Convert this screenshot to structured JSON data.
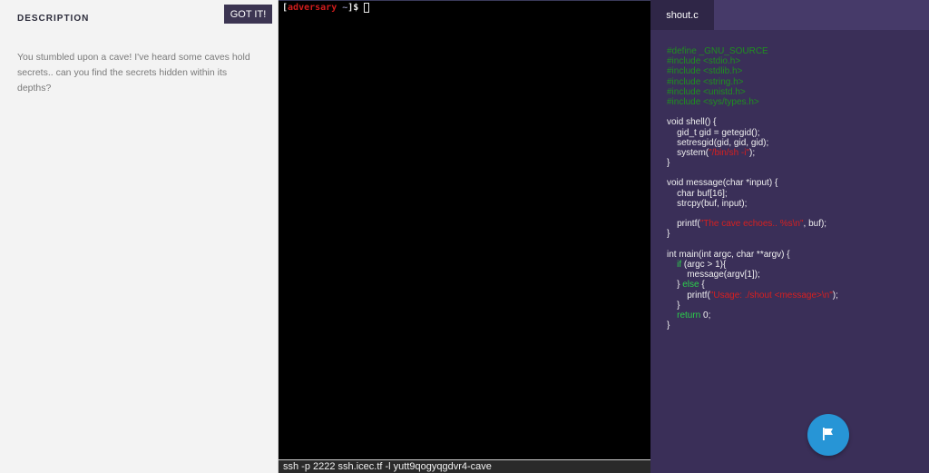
{
  "description": {
    "title": "DESCRIPTION",
    "button_label": "GOT IT!",
    "text": "You stumbled upon a cave! I've heard some caves hold secrets.. can you find the secrets hidden within its depths?"
  },
  "terminal": {
    "bracket_open": "[",
    "user": "adversary",
    "tilde": "~",
    "suffix": "]$",
    "ssh_command": "ssh -p 2222 ssh.icec.tf -l yutt9qogyqgdvr4-cave"
  },
  "code_panel": {
    "tab_label": "shout.c",
    "lines": [
      [
        [
          "c",
          "#define _GNU_SOURCE"
        ]
      ],
      [
        [
          "c",
          "#include <stdio.h>"
        ]
      ],
      [
        [
          "c",
          "#include <stdlib.h>"
        ]
      ],
      [
        [
          "c",
          "#include <string.h>"
        ]
      ],
      [
        [
          "c",
          "#include <unistd.h>"
        ]
      ],
      [
        [
          "c",
          "#include <sys/types.h>"
        ]
      ],
      [],
      [
        [
          "t",
          "void shell() {"
        ]
      ],
      [
        [
          "t",
          "    gid_t gid = getegid();"
        ]
      ],
      [
        [
          "t",
          "    setresgid(gid, gid, gid);"
        ]
      ],
      [
        [
          "t",
          "    system("
        ],
        [
          "s",
          "\"/bin/sh -i\""
        ],
        [
          "t",
          ");"
        ]
      ],
      [
        [
          "t",
          "}"
        ]
      ],
      [],
      [
        [
          "t",
          "void message(char *input) {"
        ]
      ],
      [
        [
          "t",
          "    char buf[16];"
        ]
      ],
      [
        [
          "t",
          "    strcpy(buf, input);"
        ]
      ],
      [],
      [
        [
          "t",
          "    printf("
        ],
        [
          "s",
          "\"The cave echoes.. %s\\n\""
        ],
        [
          "t",
          ", buf);"
        ]
      ],
      [
        [
          "t",
          "}"
        ]
      ],
      [],
      [
        [
          "t",
          "int main(int argc, char **argv) {"
        ]
      ],
      [
        [
          "t",
          "    "
        ],
        [
          "k",
          "if"
        ],
        [
          "t",
          " (argc > 1){"
        ]
      ],
      [
        [
          "t",
          "        message(argv[1]);"
        ]
      ],
      [
        [
          "t",
          "    } "
        ],
        [
          "k",
          "else"
        ],
        [
          "t",
          " {"
        ]
      ],
      [
        [
          "t",
          "        printf("
        ],
        [
          "s",
          "\"Usage: ./shout <message>\\n\""
        ],
        [
          "t",
          ");"
        ]
      ],
      [
        [
          "t",
          "    }"
        ]
      ],
      [
        [
          "t",
          "    "
        ],
        [
          "k",
          "return"
        ],
        [
          "t",
          " 0;"
        ]
      ],
      [
        [
          "t",
          "}"
        ]
      ]
    ]
  },
  "colors": {
    "code_comment": "#1f8f1f",
    "code_string": "#d62020",
    "code_keyword": "#2bd04a",
    "prompt_user": "#d01c1c",
    "flag_button": "#2795d6"
  },
  "icons": {
    "flag_button": "flag-icon"
  }
}
